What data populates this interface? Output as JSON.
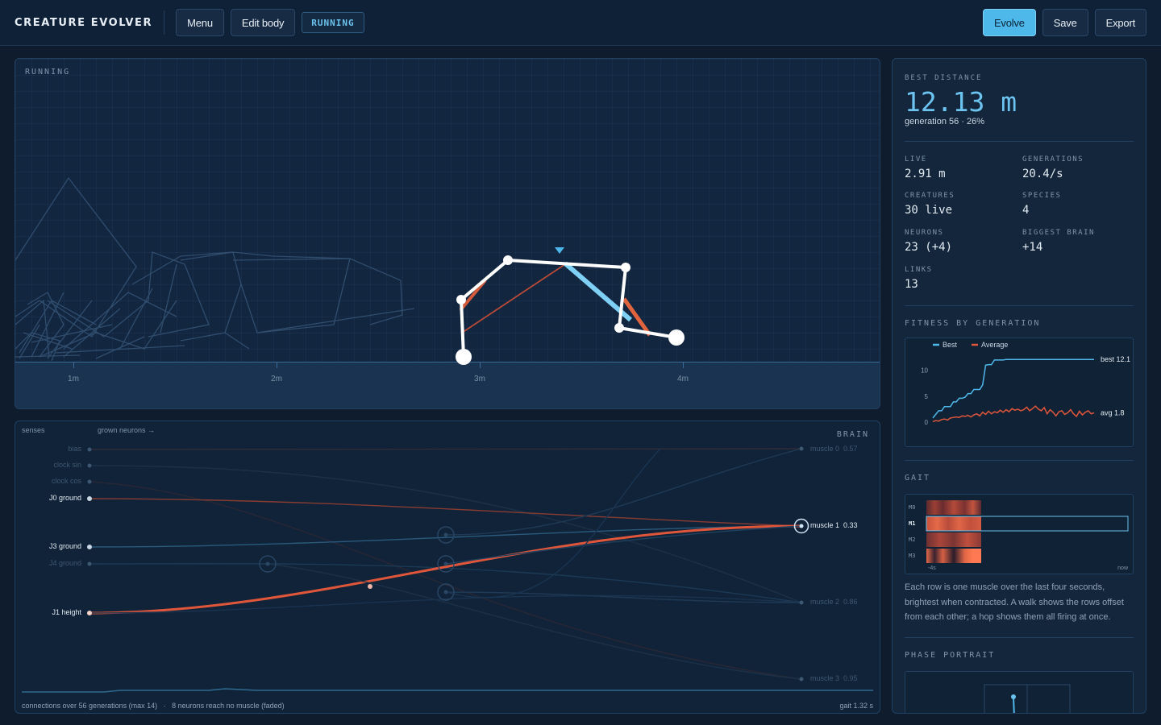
{
  "topbar": {
    "app_title": "CREATURE EVOLVER",
    "menu_label": "Menu",
    "edit_body_label": "Edit body",
    "status": "RUNNING",
    "evolve_label": "Evolve",
    "save_label": "Save",
    "export_label": "Export"
  },
  "sim": {
    "label": "RUNNING",
    "ticks": [
      "1m",
      "2m",
      "3m",
      "4m"
    ]
  },
  "brain": {
    "header_senses": "senses",
    "header_grown": "grown neurons →",
    "label": "BRAIN",
    "senses": [
      {
        "label": "bias",
        "active": false
      },
      {
        "label": "clock sin",
        "active": false
      },
      {
        "label": "clock cos",
        "active": false
      },
      {
        "label": "J0 ground",
        "active": true
      },
      {
        "label": "J3 ground",
        "active": true
      },
      {
        "label": "J4 ground",
        "active": false
      },
      {
        "label": "J1 height",
        "active": true
      }
    ],
    "outputs": [
      {
        "label": "muscle 0",
        "value": "0.57",
        "active": false
      },
      {
        "label": "muscle 1",
        "value": "0.33",
        "active": true
      },
      {
        "label": "muscle 2",
        "value": "0.86",
        "active": false
      },
      {
        "label": "muscle 3",
        "value": "0.95",
        "active": false
      }
    ],
    "footer": "connections over 56 generations (max 14)   ·   8 neurons reach no muscle (faded)",
    "gait_period": "gait 1.32 s"
  },
  "side": {
    "best_label": "BEST DISTANCE",
    "best_value": "12.13 m",
    "best_sub": "generation 56 · 26%",
    "stats": [
      {
        "label": "LIVE",
        "value": "2.91 m"
      },
      {
        "label": "GENERATIONS",
        "value": "20.4/s"
      },
      {
        "label": "CREATURES",
        "value": "30 live"
      },
      {
        "label": "SPECIES",
        "value": "4"
      },
      {
        "label": "NEURONS",
        "value": "23 (+4)"
      },
      {
        "label": "BIGGEST BRAIN",
        "value": "+14"
      },
      {
        "label": "LINKS",
        "value": "13"
      }
    ],
    "fitness_label": "FITNESS BY GENERATION",
    "gait_label": "GAIT",
    "gait_rows": [
      "M0",
      "M1",
      "M2",
      "M3"
    ],
    "gait_axis_left": "-4s",
    "gait_axis_right": "now",
    "gait_desc": "Each row is one muscle over the last four seconds, brightest when contracted. A walk shows the rows offset from each other; a hop shows them all firing at once.",
    "phase_label": "PHASE PORTRAIT"
  },
  "chart_data": {
    "type": "line",
    "legend": [
      "Best",
      "Average"
    ],
    "legend_position": "top-left",
    "y_ticks": [
      "10",
      "5",
      "0"
    ],
    "ylim": [
      0,
      14
    ],
    "xlim": [
      0,
      56
    ],
    "end_labels": {
      "best": "best 12.1",
      "avg": "avg 1.8"
    },
    "series": [
      {
        "name": "Best",
        "color": "#4fb8ea",
        "values": [
          0.8,
          1.5,
          2.2,
          2.2,
          3.0,
          3.0,
          3.0,
          3.9,
          3.9,
          4.6,
          4.6,
          4.8,
          5.5,
          5.5,
          6.3,
          6.3,
          6.3,
          7.2,
          11.0,
          11.1,
          11.1,
          12.0,
          12.0,
          12.0,
          12.0,
          12.1,
          12.1,
          12.1,
          12.1,
          12.1,
          12.1,
          12.1,
          12.1,
          12.1,
          12.1,
          12.1,
          12.1,
          12.1,
          12.1,
          12.1,
          12.1,
          12.1,
          12.1,
          12.1,
          12.1,
          12.1,
          12.1,
          12.1,
          12.1,
          12.1,
          12.1,
          12.1,
          12.1,
          12.1,
          12.1,
          12.1
        ]
      },
      {
        "name": "Average",
        "color": "#e0563a",
        "values": [
          0.1,
          0.3,
          0.2,
          0.5,
          0.6,
          0.4,
          0.8,
          0.9,
          1.0,
          0.9,
          1.2,
          1.1,
          1.3,
          1.0,
          1.4,
          1.6,
          1.2,
          1.9,
          1.5,
          2.1,
          1.6,
          2.0,
          1.8,
          2.3,
          1.9,
          2.4,
          2.0,
          2.6,
          2.3,
          2.5,
          2.2,
          2.4,
          2.9,
          2.2,
          2.6,
          3.1,
          2.5,
          2.2,
          2.8,
          1.6,
          2.4,
          1.9,
          1.2,
          2.0,
          2.2,
          1.5,
          1.8,
          2.4,
          1.6,
          1.1,
          2.1,
          1.4,
          1.9,
          2.2,
          1.6,
          1.8
        ]
      }
    ]
  }
}
